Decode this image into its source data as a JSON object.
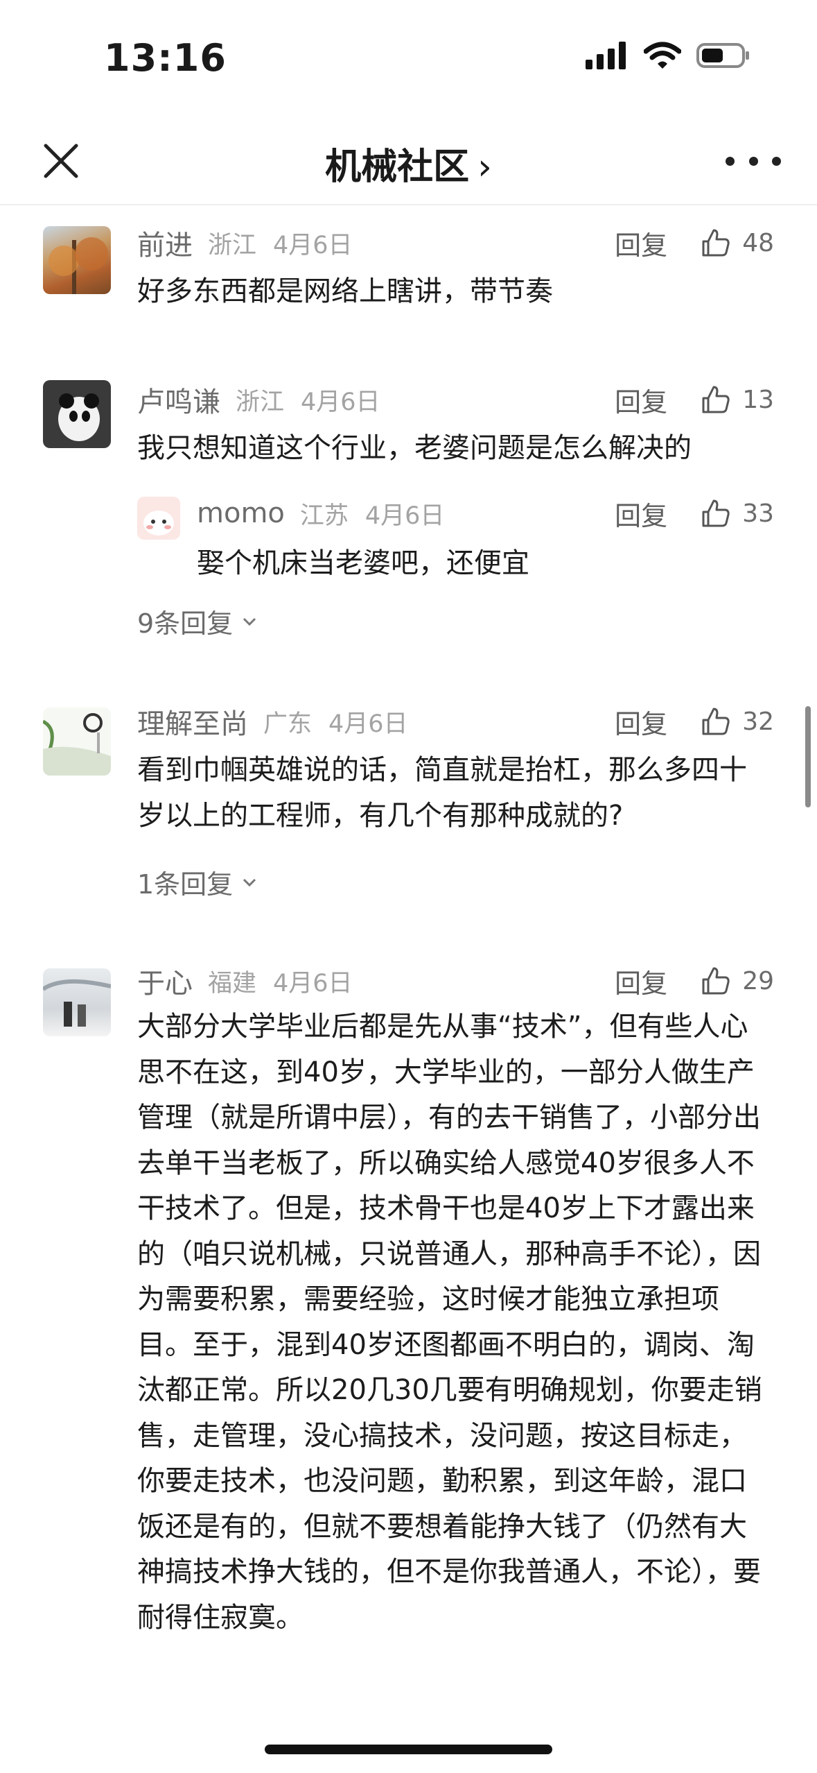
{
  "status_bar": {
    "time": "13:16"
  },
  "nav": {
    "title": "机械社区",
    "chevron": "›"
  },
  "comments": [
    {
      "name": "前进",
      "region": "浙江",
      "date": "4月6日",
      "reply_label": "回复",
      "likes": "48",
      "text": "好多东西都是网络上瞎讲，带节奏"
    },
    {
      "name": "卢鸣谦",
      "region": "浙江",
      "date": "4月6日",
      "reply_label": "回复",
      "likes": "13",
      "text": "我只想知道这个行业，老婆问题是怎么解决的",
      "sub_reply": {
        "name": "momo",
        "region": "江苏",
        "date": "4月6日",
        "reply_label": "回复",
        "likes": "33",
        "text": "娶个机床当老婆吧，还便宜"
      },
      "more_replies": "9条回复"
    },
    {
      "name": "理解至尚",
      "region": "广东",
      "date": "4月6日",
      "reply_label": "回复",
      "likes": "32",
      "text": "看到巾帼英雄说的话，简直就是抬杠，那么多四十岁以上的工程师，有几个有那种成就的?",
      "more_replies": "1条回复"
    },
    {
      "name": "于心",
      "region": "福建",
      "date": "4月6日",
      "reply_label": "回复",
      "likes": "29",
      "text": "大部分大学毕业后都是先从事“技术”，但有些人心思不在这，到40岁，大学毕业的，一部分人做生产管理（就是所谓中层），有的去干销售了，小部分出去单干当老板了，所以确实给人感觉40岁很多人不干技术了。但是，技术骨干也是40岁上下才露出来的（咱只说机械，只说普通人，那种高手不论），因为需要积累，需要经验，这时候才能独立承担项目。至于，混到40岁还图都画不明白的，调岗、淘汰都正常。所以20几30几要有明确规划，你要走销售，走管理，没心搞技术，没问题，按这目标走，你要走技术，也没问题，勤积累，到这年龄，混口饭还是有的，但就不要想着能挣大钱了（仍然有大神搞技术挣大钱的，但不是你我普通人，不论），要耐得住寂寞。"
    }
  ]
}
